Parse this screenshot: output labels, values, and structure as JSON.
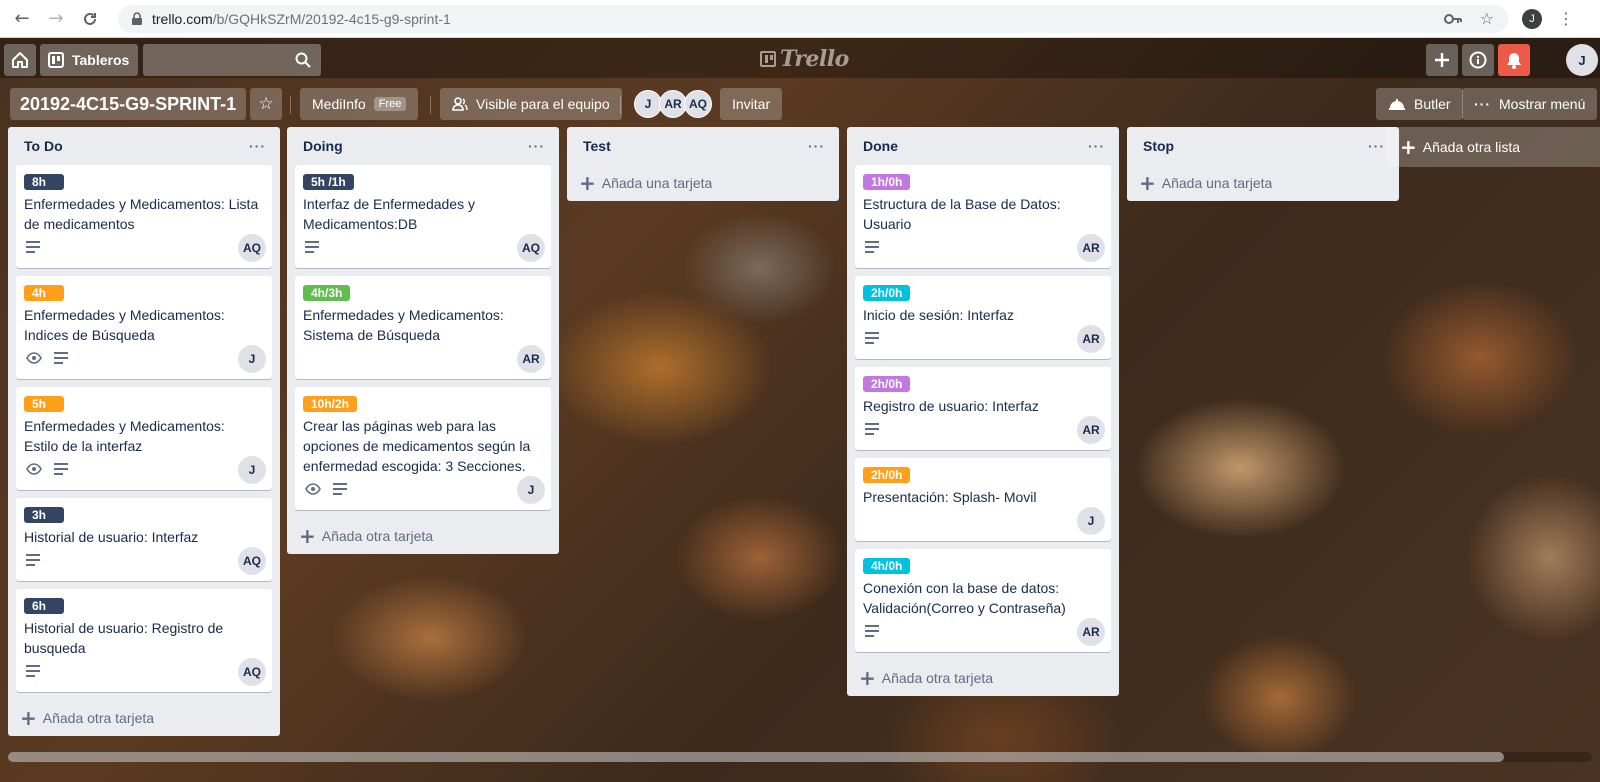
{
  "browser": {
    "url_host": "trello.com",
    "url_path": "/b/GQHkSZrM/20192-4c15-g9-sprint-1",
    "profile_initial": "J"
  },
  "header": {
    "boards_label": "Tableros",
    "logo_text": "Trello",
    "user_initial": "J"
  },
  "board": {
    "title": "20192-4C15-G9-SPRINT-1",
    "team_label": "MediInfo",
    "team_plan": "Free",
    "visibility_label": "Visible para el equipo",
    "members": [
      "J",
      "AR",
      "AQ"
    ],
    "invite_label": "Invitar",
    "butler_label": "Butler",
    "menu_label": "Mostrar menú",
    "add_list_label": "Añada otra lista"
  },
  "colors": {
    "navy": "#344563",
    "orange": "#ff9f1a",
    "green": "#61bd4f",
    "purple": "#c377e0",
    "sky": "#00c2e0",
    "red": "#eb5a46"
  },
  "lists": [
    {
      "name": "To Do",
      "add_label": "Añada otra tarjeta",
      "cards": [
        {
          "label": "8h",
          "color": "#344563",
          "title": "Enfermedades y Medicamentos: Lista de medicamentos",
          "eye": false,
          "member": "AQ"
        },
        {
          "label": "4h",
          "color": "#ff9f1a",
          "title": "Enfermedades y Medicamentos: Indices de Búsqueda",
          "eye": true,
          "member": "J"
        },
        {
          "label": "5h",
          "color": "#ff9f1a",
          "title": "Enfermedades y Medicamentos: Estilo de la interfaz",
          "eye": true,
          "member": "J"
        },
        {
          "label": "3h",
          "color": "#344563",
          "title": "Historial de usuario: Interfaz",
          "eye": false,
          "member": "AQ"
        },
        {
          "label": "6h",
          "color": "#344563",
          "title": "Historial de usuario: Registro de busqueda",
          "eye": false,
          "member": "AQ"
        }
      ]
    },
    {
      "name": "Doing",
      "add_label": "Añada otra tarjeta",
      "cards": [
        {
          "label": "5h /1h",
          "color": "#344563",
          "title": "Interfaz de Enfermedades y Medicamentos:DB",
          "eye": false,
          "member": "AQ"
        },
        {
          "label": "4h/3h",
          "color": "#61bd4f",
          "title": "Enfermedades y Medicamentos: Sistema de Búsqueda",
          "eye": false,
          "member": "AR",
          "no_badges": true
        },
        {
          "label": "10h/2h",
          "color": "#ff9f1a",
          "title": "Crear las páginas web para las opciones de medicamentos según la enfermedad escogida: 3 Secciones.",
          "eye": true,
          "member": "J"
        }
      ]
    },
    {
      "name": "Test",
      "add_label": "Añada una tarjeta",
      "cards": []
    },
    {
      "name": "Done",
      "add_label": "Añada otra tarjeta",
      "cards": [
        {
          "label": "1h/0h",
          "color": "#c377e0",
          "title": "Estructura de la Base de Datos: Usuario",
          "eye": false,
          "member": "AR"
        },
        {
          "label": "2h/0h",
          "color": "#00c2e0",
          "title": "Inicio de sesión: Interfaz",
          "eye": false,
          "member": "AR"
        },
        {
          "label": "2h/0h",
          "color": "#c377e0",
          "title": "Registro de usuario: Interfaz",
          "eye": false,
          "member": "AR"
        },
        {
          "label": "2h/0h",
          "color": "#ff9f1a",
          "title": "Presentación: Splash- Movil",
          "eye": false,
          "member": "J",
          "no_badges": true
        },
        {
          "label": "4h/0h",
          "color": "#00c2e0",
          "title": "Conexión con la base de datos: Validación(Correo y Contraseña)",
          "eye": false,
          "member": "AR"
        }
      ]
    },
    {
      "name": "Stop",
      "add_label": "Añada una tarjeta",
      "cards": []
    }
  ]
}
